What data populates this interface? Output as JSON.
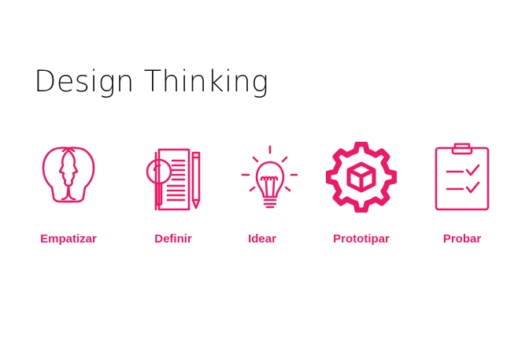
{
  "title": "Design Thinking",
  "accent_color": "#ee1866",
  "steps": [
    {
      "label": "Empatizar",
      "icon": "two-heads-icon"
    },
    {
      "label": "Definir",
      "icon": "magnifier-document-pencil-icon"
    },
    {
      "label": "Idear",
      "icon": "lightbulb-icon"
    },
    {
      "label": "Prototipar",
      "icon": "gear-cube-icon"
    },
    {
      "label": "Probar",
      "icon": "clipboard-checklist-icon"
    }
  ]
}
